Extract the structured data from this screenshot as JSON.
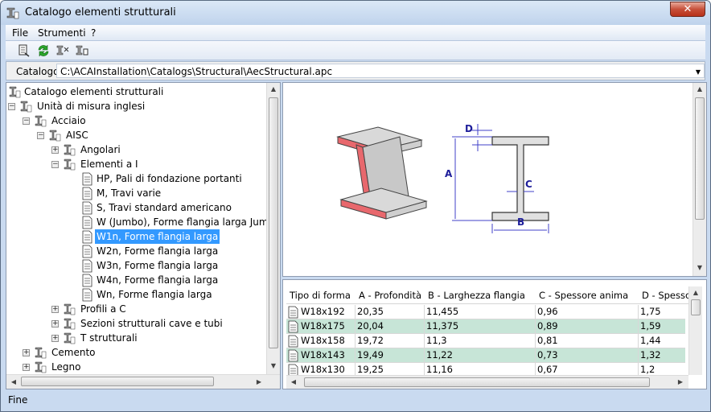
{
  "window": {
    "title": "Catalogo elementi strutturali",
    "close_label": "✕"
  },
  "menu": {
    "file": "File",
    "strumenti": "Strumenti",
    "help": "?"
  },
  "toolbar": {
    "icons": [
      "new-catalog-icon",
      "refresh-icon",
      "filter-icon",
      "expand-icon"
    ]
  },
  "catalog": {
    "label": "Catalogo",
    "path": "C:\\ACAInstallation\\Catalogs\\Structural\\AecStructural.apc"
  },
  "tree": {
    "root": "Catalogo elementi strutturali",
    "units": "Unità di misura inglesi",
    "acciaio": "Acciaio",
    "aisc": "AISC",
    "angolari": "Angolari",
    "elementi_i": "Elementi a I",
    "hp": "HP, Pali di fondazione portanti",
    "m": "M, Travi varie",
    "s": "S, Travi standard americano",
    "w_jumbo": "W (Jumbo), Forme flangia larga Jumbo",
    "w1n": "W1n, Forme flangia larga",
    "w2n": "W2n, Forme flangia larga",
    "w3n": "W3n, Forme flangia larga",
    "w4n": "W4n, Forme flangia larga",
    "wn": "Wn, Forme flangia larga",
    "profili_c": "Profili a C",
    "sezioni_cave": "Sezioni strutturali cave e tubi",
    "t_strutturali": "T strutturali",
    "cemento": "Cemento",
    "legno": "Legno"
  },
  "preview": {
    "labels": {
      "d": "D",
      "a": "A",
      "c": "C",
      "b": "B"
    }
  },
  "grid": {
    "columns": [
      "Tipo di forma",
      "A - Profondità",
      "B - Larghezza flangia",
      "C - Spessore anima",
      "D - Spessor"
    ],
    "rows": [
      {
        "name": "W18x192",
        "a": "20,35",
        "b": "11,455",
        "c": "0,96",
        "d": "1,75"
      },
      {
        "name": "W18x175",
        "a": "20,04",
        "b": "11,375",
        "c": "0,89",
        "d": "1,59"
      },
      {
        "name": "W18x158",
        "a": "19,72",
        "b": "11,3",
        "c": "0,81",
        "d": "1,44"
      },
      {
        "name": "W18x143",
        "a": "19,49",
        "b": "11,22",
        "c": "0,73",
        "d": "1,32"
      },
      {
        "name": "W18x130",
        "a": "19,25",
        "b": "11,16",
        "c": "0,67",
        "d": "1,2"
      }
    ]
  },
  "status": {
    "text": "Fine"
  }
}
